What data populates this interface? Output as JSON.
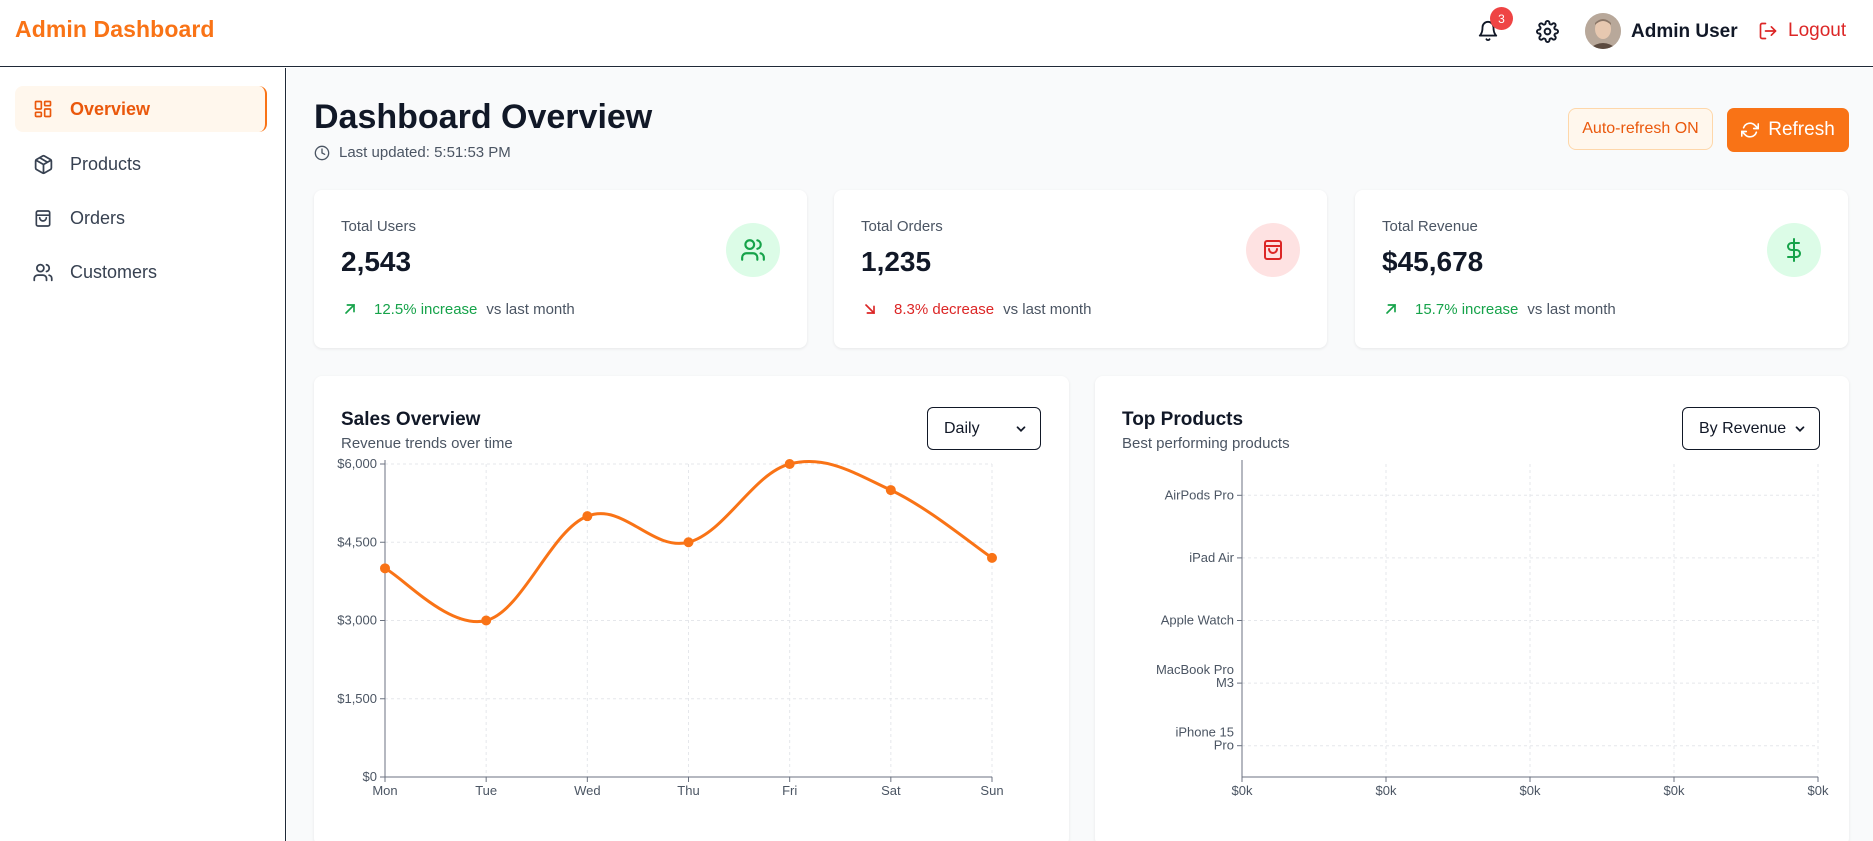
{
  "header": {
    "brand": "Admin Dashboard",
    "notification_count": "3",
    "user_name": "Admin User",
    "logout_label": "Logout"
  },
  "sidebar": {
    "items": [
      {
        "label": "Overview",
        "icon": "grid-icon",
        "active": true
      },
      {
        "label": "Products",
        "icon": "box-icon",
        "active": false
      },
      {
        "label": "Orders",
        "icon": "shopping-bag-icon",
        "active": false
      },
      {
        "label": "Customers",
        "icon": "users-icon",
        "active": false
      }
    ]
  },
  "main": {
    "title": "Dashboard Overview",
    "last_updated": "Last updated: 5:51:53 PM",
    "auto_refresh_label": "Auto-refresh ON",
    "refresh_label": "Refresh"
  },
  "stats": [
    {
      "label": "Total Users",
      "value": "2,543",
      "delta": "12.5% increase",
      "suffix": "vs last month",
      "trend": "up",
      "icon": "users-icon",
      "color": "#16a34a",
      "bg": "#dcfce7"
    },
    {
      "label": "Total Orders",
      "value": "1,235",
      "delta": "8.3% decrease",
      "suffix": "vs last month",
      "trend": "down",
      "icon": "shopping-bag-icon",
      "color": "#dc2626",
      "bg": "#fee2e2"
    },
    {
      "label": "Total Revenue",
      "value": "$45,678",
      "delta": "15.7% increase",
      "suffix": "vs last month",
      "trend": "up",
      "icon": "dollar-icon",
      "color": "#16a34a",
      "bg": "#dcfce7"
    }
  ],
  "sales_panel": {
    "title": "Sales Overview",
    "subtitle": "Revenue trends over time",
    "select_value": "Daily"
  },
  "products_panel": {
    "title": "Top Products",
    "subtitle": "Best performing products",
    "select_value": "By Revenue"
  },
  "colors": {
    "accent": "#f97316",
    "up": "#16a34a",
    "down": "#dc2626"
  },
  "chart_data": [
    {
      "type": "line",
      "categories": [
        "Mon",
        "Tue",
        "Wed",
        "Thu",
        "Fri",
        "Sat",
        "Sun"
      ],
      "values": [
        4000,
        3000,
        5000,
        4500,
        6000,
        5500,
        4200
      ],
      "y_ticks": [
        "$0",
        "$1,500",
        "$3,000",
        "$4,500",
        "$6,000"
      ],
      "ylim": [
        0,
        6000
      ],
      "grid": true,
      "color": "#f97316"
    },
    {
      "type": "bar",
      "orientation": "horizontal",
      "categories": [
        "AirPods Pro",
        "iPad Air",
        "Apple Watch",
        "MacBook Pro M3",
        "iPhone 15 Pro"
      ],
      "values": [
        0,
        0,
        0,
        0,
        0
      ],
      "x_ticks": [
        "$0k",
        "$0k",
        "$0k",
        "$0k",
        "$0k"
      ],
      "grid": true
    }
  ]
}
